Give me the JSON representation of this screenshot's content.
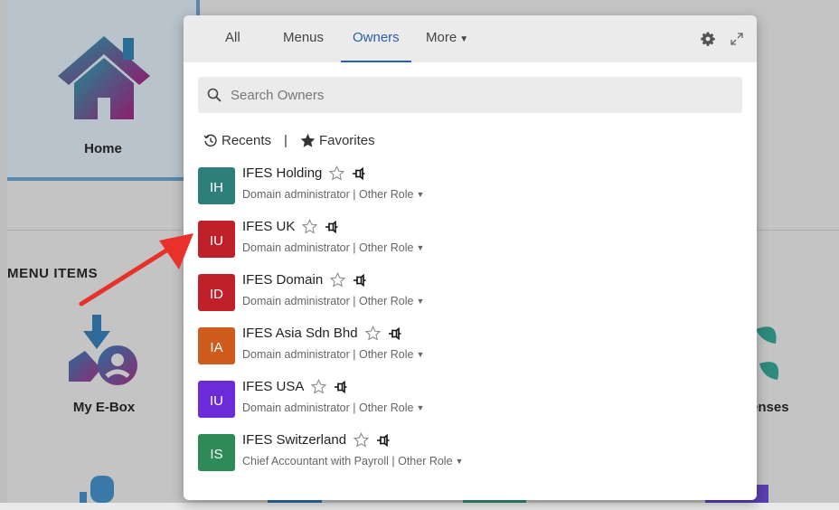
{
  "background": {
    "home_label": "Home",
    "menu_items_label": "MENU ITEMS",
    "ebox_label": "My E-Box",
    "licenses_label": "enses"
  },
  "tabs": [
    {
      "label": "All"
    },
    {
      "label": "Menus"
    },
    {
      "label": "Owners",
      "active": true
    },
    {
      "label": "More"
    }
  ],
  "toolbar_icons": [
    "gear-icon",
    "expand-icon"
  ],
  "search": {
    "placeholder": "Search Owners",
    "value": ""
  },
  "filters": {
    "recents": "Recents",
    "separator": "|",
    "favorites": "Favorites"
  },
  "owners": [
    {
      "initials": "IH",
      "name": "IFES Holding",
      "role": "Domain administrator",
      "other_role": "Other Role",
      "color": "#2e7f7a"
    },
    {
      "initials": "IU",
      "name": "IFES UK",
      "role": "Domain administrator",
      "other_role": "Other Role",
      "color": "#c0202a"
    },
    {
      "initials": "ID",
      "name": "IFES Domain",
      "role": "Domain administrator",
      "other_role": "Other Role",
      "color": "#c0202a"
    },
    {
      "initials": "IA",
      "name": "IFES Asia Sdn Bhd",
      "role": "Domain administrator",
      "other_role": "Other Role",
      "color": "#cf5b1d"
    },
    {
      "initials": "IU",
      "name": "IFES USA",
      "role": "Domain administrator",
      "other_role": "Other Role",
      "color": "#6c2bd9"
    },
    {
      "initials": "IS",
      "name": "IFES Switzerland",
      "role": "Chief Accountant with Payroll",
      "other_role": "Other Role",
      "color": "#2e8a57"
    }
  ],
  "colors": {
    "accent": "#2c5fab",
    "annotation_arrow": "#e8312a"
  }
}
